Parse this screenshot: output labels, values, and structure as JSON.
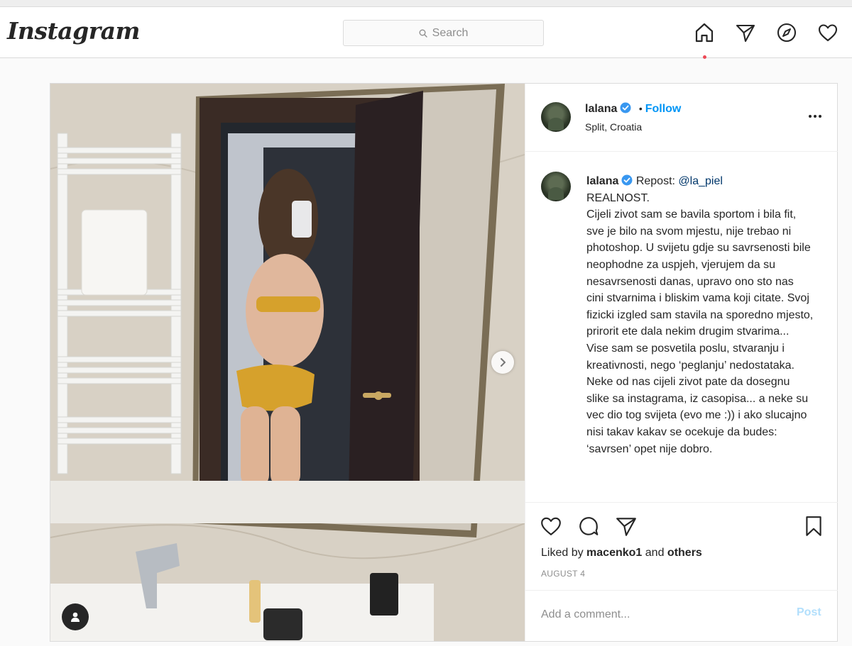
{
  "header": {
    "logo": "Instagram",
    "search_placeholder": "Search",
    "icons": [
      "home-icon",
      "direct-message-icon",
      "explore-compass-icon",
      "activity-heart-icon"
    ]
  },
  "post": {
    "author": {
      "username": "lalana",
      "verified": true,
      "follow_label": "Follow",
      "separator": "•",
      "location": "Split, Croatia"
    },
    "caption": {
      "username": "lalana",
      "repost_prefix": "Repost:",
      "repost_mention": "@la_piel",
      "title": "REALNOST.",
      "body": "Cijeli zivot sam se bavila sportom i bila fit, sve je bilo na svom mjestu, nije trebao ni photoshop. U svijetu gdje su savrsenosti bile neophodne za uspjeh, vjerujem da su nesavrsenosti danas, upravo ono sto nas cini stvarnima i bliskim vama koji citate. Svoj fizicki izgled sam stavila na sporedno mjesto, prirorit ete dala nekim drugim stvarima... Vise sam se posvetila poslu, stvaranju i kreativnosti, nego ‘peglanju’ nedostataka. Neke od nas cijeli zivot pate da dosegnu slike sa instagrama, iz casopisa... a neke su vec dio tog svijeta (evo me :)) i ako slucajno nisi takav kakav se ocekuje da budes: ‘savrsen’ opet nije dobro."
    },
    "likes": {
      "prefix": "Liked by",
      "user": "macenko1",
      "joiner": "and",
      "others": "others"
    },
    "date": "AUGUST 4",
    "comment": {
      "placeholder": "Add a comment...",
      "post_label": "Post"
    },
    "colors": {
      "link_blue": "#0095f6",
      "post_disabled": "#b2dffc",
      "text": "#262626",
      "muted": "#8e8e8e"
    }
  }
}
